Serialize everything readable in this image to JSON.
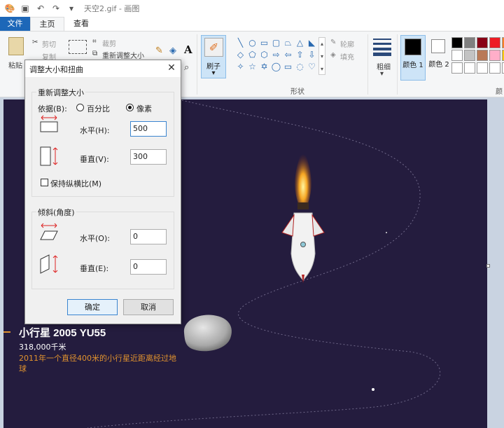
{
  "window": {
    "title": "天空2.gif - 画图"
  },
  "tabs": {
    "file": "文件",
    "home": "主页",
    "view": "查看"
  },
  "ribbon": {
    "clipboard": {
      "paste": "粘贴",
      "cut": "剪切",
      "copy": "复制"
    },
    "image": {
      "crop": "裁剪",
      "resize": "重新调整大小"
    },
    "brushes": "刷子",
    "outline": "轮廓",
    "fill": "填充",
    "shapes_group": "形状",
    "size": "粗细",
    "color1": "颜色 1",
    "color2": "颜色 2",
    "colors_group": "颜",
    "shape_glyphs": [
      "╲",
      "○",
      "▭",
      "▢",
      "⏢",
      "△",
      "◣",
      "◇",
      "⬠",
      "⬡",
      "⇨",
      "⇦",
      "⇧",
      "⇩",
      "✧",
      "☆",
      "✡",
      "◯",
      "▭",
      "◌",
      "♡"
    ],
    "palette": [
      "#000000",
      "#7f7f7f",
      "#880015",
      "#ed1c24",
      "#ff7f27",
      "#ffffff",
      "#c3c3c3",
      "#b97a57",
      "#ffaec9",
      "#ffc90e",
      "#ffffff",
      "#ffffff",
      "#ffffff",
      "#ffffff",
      "#ffffff"
    ]
  },
  "dialog": {
    "title": "调整大小和扭曲",
    "resize_group": "重新调整大小",
    "by_label": "依据(B):",
    "percent": "百分比",
    "pixels": "像素",
    "horizontal_label": "水平(H):",
    "horizontal_value": "500",
    "vertical_label": "垂直(V):",
    "vertical_value": "300",
    "keep_ratio": "保持纵横比(M)",
    "skew_group": "倾斜(角度)",
    "skew_h_label": "水平(O):",
    "skew_h_value": "0",
    "skew_v_label": "垂直(E):",
    "skew_v_value": "0",
    "ok": "确定",
    "cancel": "取消"
  },
  "canvas": {
    "title": "小行星 2005 YU55",
    "distance": "318,000千米",
    "description": "2011年一个直径400米的小行星近距离经过地球",
    "background": "#241c3e",
    "accent": "#e0922e"
  }
}
